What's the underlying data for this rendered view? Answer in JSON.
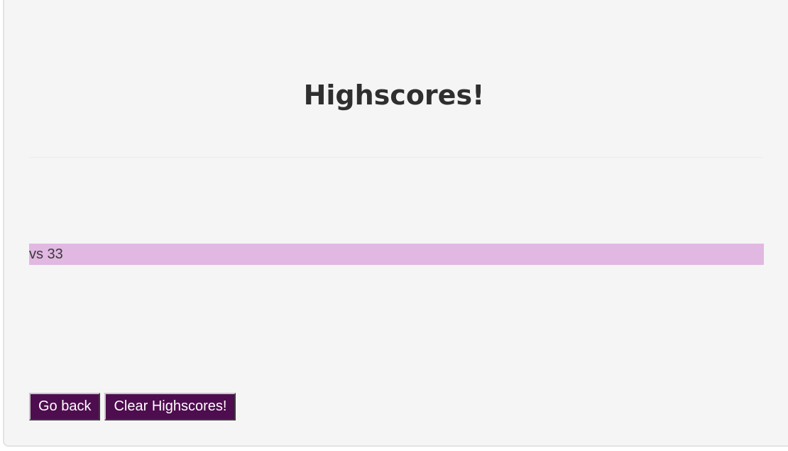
{
  "page": {
    "title": "Highscores!"
  },
  "scores": [
    {
      "text": "vs 33"
    }
  ],
  "buttons": {
    "go_back": "Go back",
    "clear": "Clear Highscores!"
  },
  "colors": {
    "background": "#f5f5f5",
    "score_row": "#e1b8e2",
    "button_bg": "#4e0d4f",
    "button_text": "#ffffff",
    "title_text": "#2f2f2f"
  }
}
